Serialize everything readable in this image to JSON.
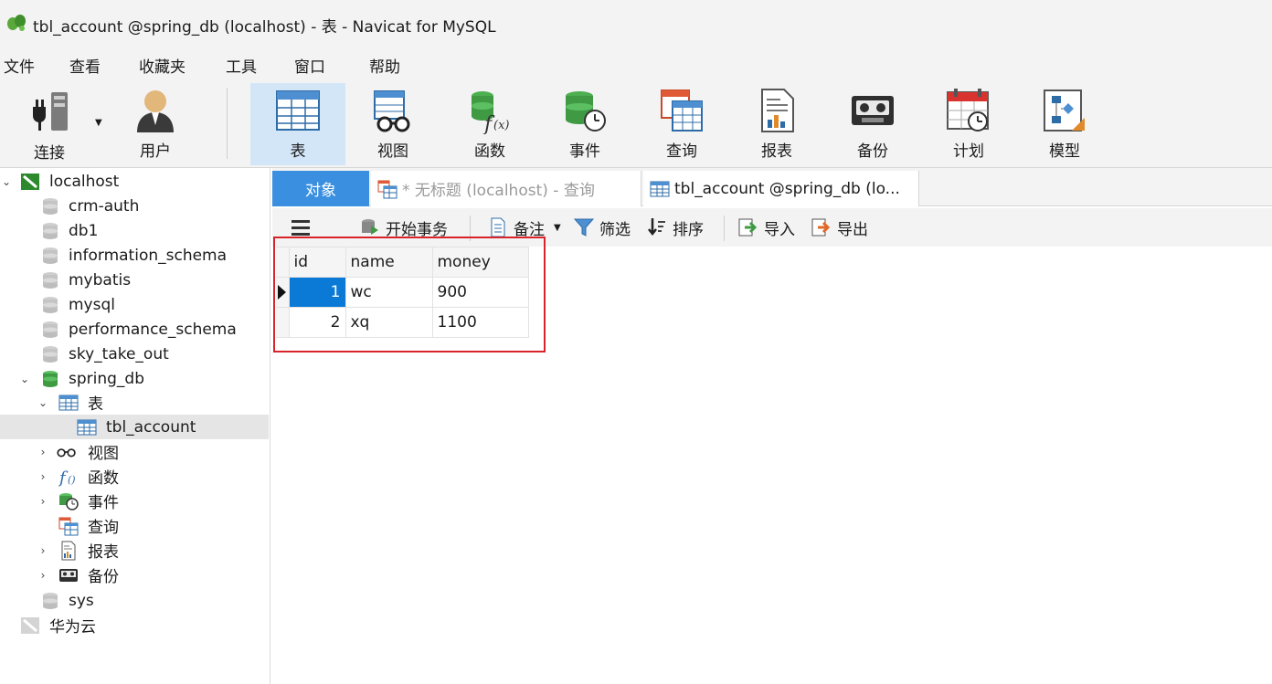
{
  "window": {
    "title": "tbl_account @spring_db (localhost) - 表 - Navicat for MySQL"
  },
  "menu": [
    "文件",
    "查看",
    "收藏夹",
    "工具",
    "窗口",
    "帮助"
  ],
  "toolbar": {
    "connect": "连接",
    "user": "用户",
    "table": "表",
    "view": "视图",
    "function": "函数",
    "event": "事件",
    "query": "查询",
    "report": "报表",
    "backup": "备份",
    "schedule": "计划",
    "model": "模型"
  },
  "sidebar": {
    "connection": "localhost",
    "databases": [
      "crm-auth",
      "db1",
      "information_schema",
      "mybatis",
      "mysql",
      "performance_schema",
      "sky_take_out"
    ],
    "open_db": "spring_db",
    "tables_group": "表",
    "selected_table": "tbl_account",
    "groups": {
      "views": "视图",
      "functions": "函数",
      "events": "事件",
      "queries": "查询",
      "reports": "报表",
      "backups": "备份"
    },
    "sys_db": "sys",
    "cloud": "华为云"
  },
  "tabs": {
    "objects": "对象",
    "query": "* 无标题 (localhost) - 查询",
    "table": "tbl_account @spring_db (lo..."
  },
  "subtoolbar": {
    "begin_transaction": "开始事务",
    "note": "备注",
    "filter": "筛选",
    "sort": "排序",
    "import": "导入",
    "export": "导出"
  },
  "grid": {
    "columns": [
      "id",
      "name",
      "money"
    ],
    "rows": [
      [
        "1",
        "wc",
        "900"
      ],
      [
        "2",
        "xq",
        "1100"
      ]
    ]
  },
  "colors": {
    "accent": "#3a8fe0",
    "selection": "#0a7ad6",
    "highlight_box": "#d9232a",
    "db_green": "#4caf50"
  }
}
